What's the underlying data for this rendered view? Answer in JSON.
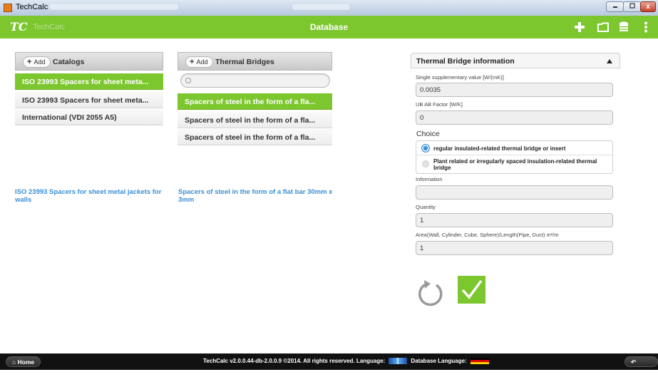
{
  "window": {
    "title": "TechCalc",
    "controls": [
      "minimize-icon",
      "maximize-icon",
      "close-icon"
    ],
    "close_glyph": "x"
  },
  "header": {
    "logo": "TC",
    "app_name": "TechCalc",
    "title": "Database",
    "icons": [
      "plus-icon",
      "folder-icon",
      "database-icon",
      "more-vertical-icon"
    ],
    "accent_color": "#7cc62e"
  },
  "catalogs": {
    "add_label": "Add",
    "title": "Catalogs",
    "items": [
      "ISO 23993 Spacers for sheet meta...",
      "ISO 23993 Spacers for sheet meta...",
      "International (VDI 2055 A5)"
    ],
    "selected_index": 0,
    "selected_full": "ISO 23993 Spacers for sheet metal jackets for walls"
  },
  "bridges": {
    "add_label": "Add",
    "title": "Thermal Bridges",
    "search_placeholder": "",
    "items": [
      "Spacers of steel in the form of a fla...",
      "Spacers of steel in the form of a fla...",
      "Spacers of steel in the form of a fla..."
    ],
    "selected_index": 0,
    "selected_full": "Spacers of steel in the form of a flat bar 30mm x 3mm"
  },
  "info": {
    "title": "Thermal Bridge information",
    "single_label": "Single supplementary value [W/(mK)]",
    "single_value": "0.0035",
    "ub_label": "UB AB Factor [W/K]",
    "ub_value": "0",
    "choice_label": "Choice",
    "choice_options": [
      "regular insulated-related thermal bridge or insert",
      "Plant related or irregularly spaced insulation-related thermal bridge"
    ],
    "choice_selected": 0,
    "information_label": "Information",
    "information_value": "",
    "quantity_label": "Quantity",
    "quantity_value": "1",
    "area_label": "Area(Wall, Cylinder, Cube, Sphere)/Length(Pipe, Duct) m²/m",
    "area_value": "1"
  },
  "actions": {
    "reset_icon": "reset-icon",
    "confirm_icon": "checkmark-icon"
  },
  "footer": {
    "home_label": "Home",
    "back_label": "Back",
    "copyright": "TechCalc v2.0.0.44-db-2.0.0.9 ©2014. All rights reserved. Language:",
    "db_language_label": "Database Language:"
  }
}
